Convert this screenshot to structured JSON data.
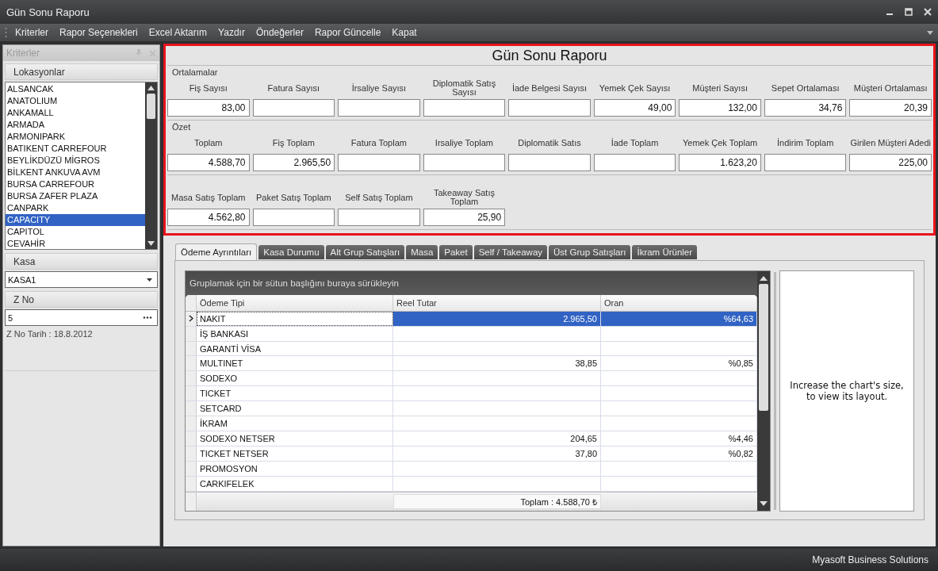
{
  "window": {
    "title": "Gün Sonu Raporu"
  },
  "menu": [
    "Kriterler",
    "Rapor Seçenekleri",
    "Excel Aktarım",
    "Yazdır",
    "Öndeğerler",
    "Rapor Güncelle",
    "Kapat"
  ],
  "sidebar": {
    "title": "Kriterler",
    "locations": {
      "title": "Lokasyonlar",
      "items": [
        {
          "label": "ALSANCAK",
          "selected": false
        },
        {
          "label": "ANATOLIUM",
          "selected": false
        },
        {
          "label": "ANKAMALL",
          "selected": false
        },
        {
          "label": "ARMADA",
          "selected": false
        },
        {
          "label": "ARMONIPARK",
          "selected": false
        },
        {
          "label": "BATIKENT CARREFOUR",
          "selected": false
        },
        {
          "label": "BEYLİKDÜZÜ MİGROS",
          "selected": false
        },
        {
          "label": "BİLKENT ANKUVA AVM",
          "selected": false
        },
        {
          "label": "BURSA CARREFOUR",
          "selected": false
        },
        {
          "label": "BURSA ZAFER PLAZA",
          "selected": false
        },
        {
          "label": "CANPARK",
          "selected": false
        },
        {
          "label": "CAPACITY",
          "selected": true
        },
        {
          "label": "CAPITOL",
          "selected": false
        },
        {
          "label": "CEVAHİR",
          "selected": false
        }
      ]
    },
    "kasa": {
      "title": "Kasa",
      "value": "KASA1"
    },
    "zno": {
      "title": "Z No",
      "value": "5",
      "info": "Z No Tarih : 18.8.2012"
    }
  },
  "report": {
    "title": "Gün Sonu Raporu",
    "sections": [
      {
        "legend": "Ortalamalar",
        "fields": [
          {
            "label": "Fiş Sayısı",
            "value": "83,00"
          },
          {
            "label": "Fatura Sayısı"
          },
          {
            "label": "İrsaliye Sayısı"
          },
          {
            "label": "Diplomatik Satış Sayısı"
          },
          {
            "label": "İade Belgesi Sayısı"
          },
          {
            "label": "Yemek Çek Sayısı",
            "value": "49,00"
          },
          {
            "label": "Müşteri Sayısı",
            "value": "132,00"
          },
          {
            "label": "Sepet Ortalaması",
            "value": "34,76"
          },
          {
            "label": "Müşteri Ortalaması",
            "value": "20,39"
          }
        ]
      },
      {
        "legend": "Özet",
        "fields": [
          {
            "label": "Toplam",
            "value": "4.588,70"
          },
          {
            "label": "Fiş Toplam",
            "value": "2.965,50"
          },
          {
            "label": "Fatura Toplam"
          },
          {
            "label": "Irsaliye Toplam"
          },
          {
            "label": "Diplomatik Satıs"
          },
          {
            "label": "İade Toplam"
          },
          {
            "label": "Yemek Çek Toplam",
            "value": "1.623,20"
          },
          {
            "label": "İndirim Toplam"
          },
          {
            "label": "Girilen Müşteri Adedi",
            "value": "225,00"
          }
        ]
      },
      {
        "fields": [
          {
            "label": "Masa Satış Toplam",
            "value": "4.562,80"
          },
          {
            "label": "Paket Satış Toplam"
          },
          {
            "label": "Self Satış Toplam"
          },
          {
            "label": "Takeaway Satış Toplam",
            "value": "25,90"
          }
        ]
      }
    ]
  },
  "tabs": [
    {
      "label": "Ödeme Ayrıntıları",
      "selected": true
    },
    {
      "label": "Kasa Durumu",
      "selected": false
    },
    {
      "label": "Alt Grup Satışları",
      "selected": false
    },
    {
      "label": "Masa",
      "selected": false
    },
    {
      "label": "Paket",
      "selected": false
    },
    {
      "label": "Self / Takeaway",
      "selected": false
    },
    {
      "label": "Üst Grup Satışları",
      "selected": false
    },
    {
      "label": "İkram Ürünler",
      "selected": false
    }
  ],
  "grid": {
    "group_hint": "Gruplamak için bir sütun başlığını buraya sürükleyin",
    "columns": [
      "Ödeme Tipi",
      "Reel Tutar",
      "Oran"
    ],
    "rows": [
      {
        "cells": [
          "NAKIT",
          "2.965,50",
          "%64,63"
        ],
        "selected": true
      },
      {
        "cells": [
          "İŞ BANKASI",
          "",
          ""
        ],
        "selected": false
      },
      {
        "cells": [
          "GARANTİ VİSA",
          "",
          ""
        ],
        "selected": false
      },
      {
        "cells": [
          "MULTINET",
          "38,85",
          "%0,85"
        ],
        "selected": false
      },
      {
        "cells": [
          "SODEXO",
          "",
          ""
        ],
        "selected": false
      },
      {
        "cells": [
          "TICKET",
          "",
          ""
        ],
        "selected": false
      },
      {
        "cells": [
          "SETCARD",
          "",
          ""
        ],
        "selected": false
      },
      {
        "cells": [
          "İKRAM",
          "",
          ""
        ],
        "selected": false
      },
      {
        "cells": [
          "SODEXO NETSER",
          "204,65",
          "%4,46"
        ],
        "selected": false
      },
      {
        "cells": [
          "TICKET NETSER",
          "37,80",
          "%0,82"
        ],
        "selected": false
      },
      {
        "cells": [
          "PROMOSYON",
          "",
          ""
        ],
        "selected": false
      },
      {
        "cells": [
          "CARKIFELEK",
          "",
          ""
        ],
        "selected": false
      }
    ],
    "footer": "Toplam : 4.588,70 ₺"
  },
  "chart_message": "Increase the chart's size, to view its layout.",
  "status_bar": "Myasoft Business Solutions"
}
